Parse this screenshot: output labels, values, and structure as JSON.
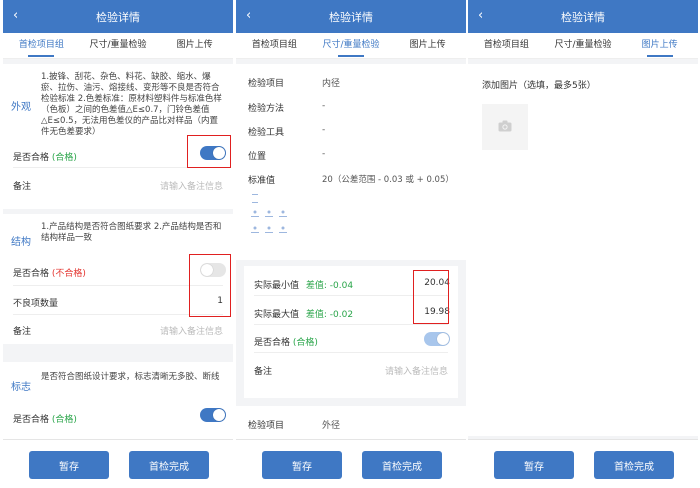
{
  "header": {
    "title": "检验详情",
    "back": "‹"
  },
  "tabs": [
    "首检项目组",
    "尺寸/重量检验",
    "图片上传"
  ],
  "panel1": {
    "appearance": {
      "title": "外观",
      "desc": "1.披锋、刮花、杂色、料花、缺胶、缩水、爆瘀、拉伤、油污、熔接线、变形等不良是否符合检验标准 2.色差标准：原材料塑料件与标准色样（色板）之间的色差值△E≤0.7，门铃色差值△E≤0.5，无法用色差仪的产品比对样品（内置件无色差要求）",
      "pass_label": "是否合格",
      "pass_value": "(合格)",
      "remark_label": "备注",
      "remark_placeholder": "请输入备注信息"
    },
    "structure": {
      "title": "结构",
      "desc": "1.产品结构是否符合图纸要求 2.产品结构是否和结构样品一致",
      "pass_label": "是否合格",
      "pass_value": "(不合格)",
      "defect_label": "不良项数量",
      "defect_count": "1",
      "remark_label": "备注",
      "remark_placeholder": "请输入备注信息"
    },
    "marking": {
      "title": "标志",
      "desc": "是否符合图纸设计要求，标志清晰无多胶、断线",
      "pass_label": "是否合格",
      "pass_value": "(合格)"
    }
  },
  "panel2": {
    "fields": [
      {
        "label": "检验项目",
        "value": "内径"
      },
      {
        "label": "检验方法",
        "value": "-"
      },
      {
        "label": "检验工具",
        "value": "-"
      },
      {
        "label": "位置",
        "value": "-"
      },
      {
        "label": "标准值",
        "value": "20（公差范围 - 0.03 或 + 0.05）"
      }
    ],
    "min_label": "实际最小值",
    "min_diff": "差值: -0.04",
    "min_value": "20.04",
    "max_label": "实际最大值",
    "max_diff": "差值: -0.02",
    "max_value": "19.98",
    "pass_label": "是否合格",
    "pass_value": "(合格)",
    "remark_label": "备注",
    "remark_placeholder": "请输入备注信息",
    "next_label": "检验项目",
    "next_value": "外径"
  },
  "panel3": {
    "add_label": "添加图片（选填，最多5张）"
  },
  "footer": {
    "save": "暂存",
    "complete": "首检完成"
  },
  "colors": {
    "primary": "#3f78c4",
    "pass": "#2aa54a",
    "fail": "#e3342f",
    "highlight": "#e02020"
  }
}
